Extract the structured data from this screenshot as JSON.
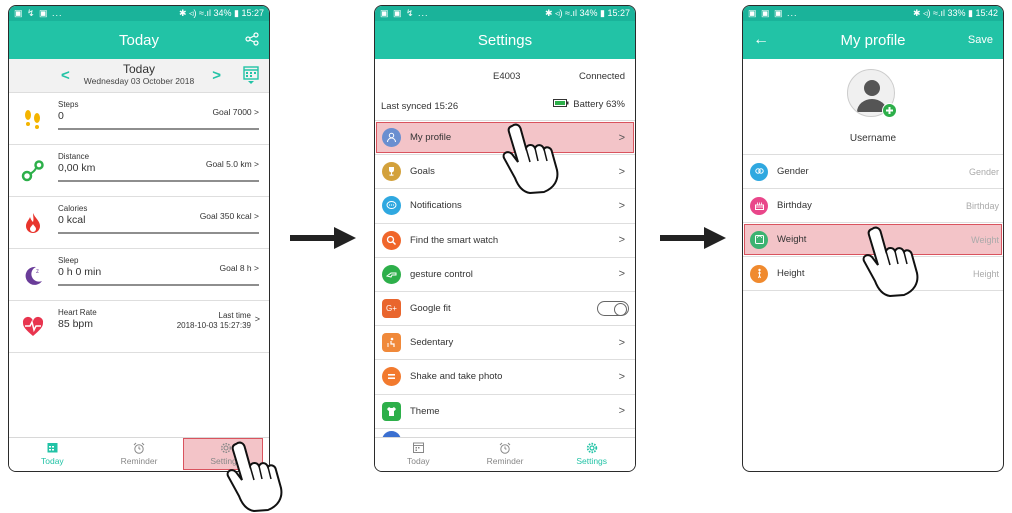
{
  "colors": {
    "accent": "#22c3a6",
    "status": "#1ab39a",
    "highlight": "#f3c4c8",
    "highlight_border": "#d9535e"
  },
  "phone1": {
    "status": {
      "left": "▣ ↯ ▣ ...",
      "right": "✱ ◃) ≈.ıl 34% ▮ 15:27"
    },
    "title": "Today",
    "share_icon": "share-icon",
    "date": {
      "title": "Today",
      "sub": "Wednesday  03  October  2018",
      "prev": "<",
      "next": ">"
    },
    "metrics": [
      {
        "name": "Steps",
        "value": "0",
        "goal": "Goal 7000 >"
      },
      {
        "name": "Distance",
        "value": "0,00 km",
        "goal": "Goal 5.0 km >"
      },
      {
        "name": "Calories",
        "value": "0 kcal",
        "goal": "Goal 350 kcal >"
      },
      {
        "name": "Sleep",
        "value": "0 h 0 min",
        "goal": "Goal 8 h >"
      },
      {
        "name": "Heart Rate",
        "value": "85 bpm",
        "goal_line1": "Last time",
        "goal_line2": "2018-10-03 15:27:39",
        "chev": ">"
      }
    ],
    "nav": [
      {
        "label": "Today"
      },
      {
        "label": "Reminder"
      },
      {
        "label": "Settings"
      }
    ]
  },
  "phone2": {
    "status": {
      "left": "▣ ▣ ↯ ...",
      "right": "✱ ◃) ≈.ıl 34% ▮ 15:27"
    },
    "title": "Settings",
    "device": "E4003",
    "connection": "Connected",
    "last_synced": "Last synced  15:26",
    "battery": "Battery  63%",
    "rows": [
      {
        "label": "My profile",
        "color": "#6a8fd0"
      },
      {
        "label": "Goals",
        "color": "#d3a13b"
      },
      {
        "label": "Notifications",
        "color": "#2fa8e0"
      },
      {
        "label": "Find the smart watch",
        "color": "#f0662b"
      },
      {
        "label": "gesture control",
        "color": "#2daf4a"
      },
      {
        "label": "Google fit",
        "color": "#e9652d"
      },
      {
        "label": "Sedentary",
        "color": "#f0893a"
      },
      {
        "label": "Shake and take photo",
        "color": "#f27a2e"
      },
      {
        "label": "Theme",
        "color": "#2daf4a"
      }
    ],
    "nav": [
      {
        "label": "Today"
      },
      {
        "label": "Reminder"
      },
      {
        "label": "Settings"
      }
    ]
  },
  "phone3": {
    "status": {
      "left": "▣ ▣ ▣ ...",
      "right": "✱ ◃) ≈.ıl 33% ▮ 15:42"
    },
    "title": "My profile",
    "back": "←",
    "save": "Save",
    "username": "Username",
    "rows": [
      {
        "label": "Gender",
        "value": "Gender",
        "color": "#2fa8e0"
      },
      {
        "label": "Birthday",
        "value": "Birthday",
        "color": "#e9468a"
      },
      {
        "label": "Weight",
        "value": "Weight",
        "color": "#3cb371"
      },
      {
        "label": "Height",
        "value": "Height",
        "color": "#f08a2e"
      }
    ]
  }
}
